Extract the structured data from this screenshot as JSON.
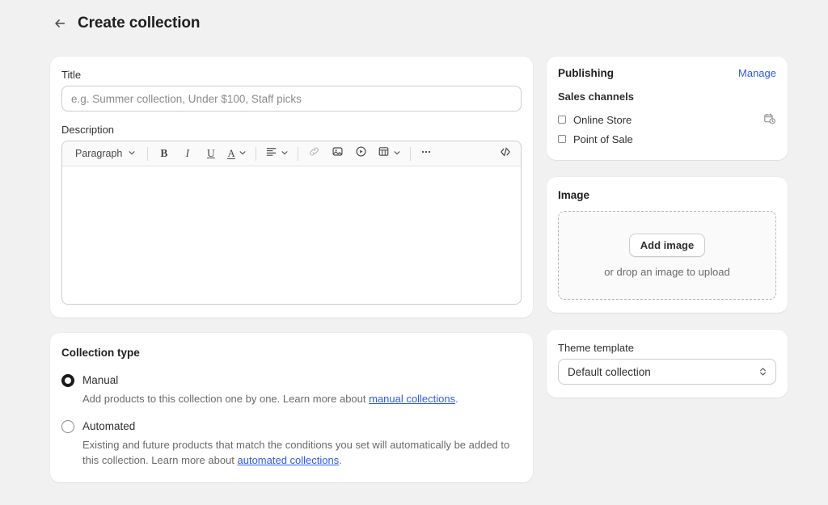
{
  "header": {
    "back_icon": "arrow-left-icon",
    "title": "Create collection"
  },
  "details": {
    "title_label": "Title",
    "title_value": "",
    "title_placeholder": "e.g. Summer collection, Under $100, Staff picks",
    "description_label": "Description",
    "description_value": "",
    "toolbar": {
      "block_style": "Paragraph",
      "bold": "B",
      "italic": "I",
      "underline": "U",
      "text_color": "A",
      "items": [
        "paragraph-style-select",
        "bold-button",
        "italic-button",
        "underline-button",
        "text-color-button",
        "align-button",
        "link-button",
        "insert-image-button",
        "insert-video-button",
        "insert-table-button",
        "more-options-button",
        "code-view-button"
      ]
    }
  },
  "collection_type": {
    "heading": "Collection type",
    "options": [
      {
        "label": "Manual",
        "selected": true,
        "help_prefix": "Add products to this collection one by one. Learn more about ",
        "help_link": "manual collections",
        "help_suffix": "."
      },
      {
        "label": "Automated",
        "selected": false,
        "help_prefix": "Existing and future products that match the conditions you set will automatically be added to this collection. Learn more about ",
        "help_link": "automated collections",
        "help_suffix": "."
      }
    ]
  },
  "publishing": {
    "title": "Publishing",
    "manage_label": "Manage",
    "sales_channels_label": "Sales channels",
    "channels": [
      {
        "name": "Online Store",
        "checked": false,
        "icon": "calendar-clock-icon"
      },
      {
        "name": "Point of Sale",
        "checked": false,
        "icon": ""
      }
    ]
  },
  "image": {
    "title": "Image",
    "add_button": "Add image",
    "drop_hint": "or drop an image to upload"
  },
  "theme_template": {
    "label": "Theme template",
    "selected": "Default collection"
  },
  "colors": {
    "page_background": "#f1f1f1",
    "card_background": "#ffffff",
    "link": "#2f5bea",
    "text_primary": "#303030",
    "text_subdued": "#6a6a6a",
    "border": "#c9cccf"
  }
}
